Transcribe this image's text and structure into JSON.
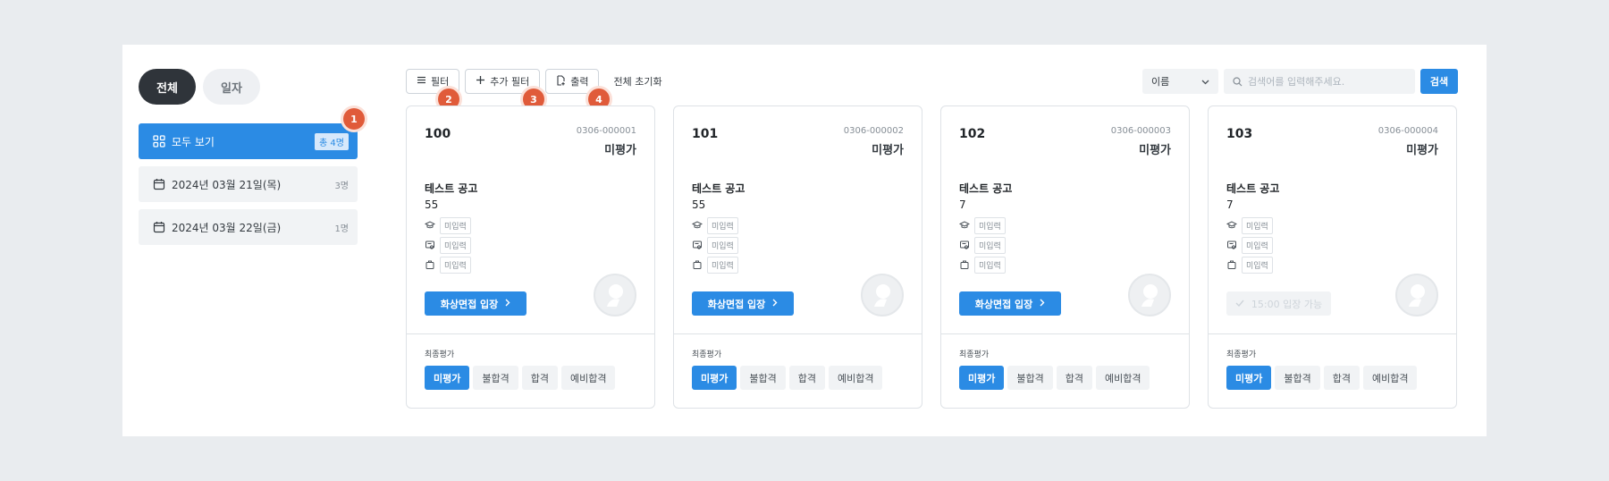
{
  "segments": [
    "전체",
    "일자"
  ],
  "sidebar": [
    {
      "label": "모두 보기",
      "count": "총 4명",
      "icon": "grid-icon"
    },
    {
      "label": "2024년 03월 21일(목)",
      "count": "3명",
      "icon": "calendar-icon"
    },
    {
      "label": "2024년 03월 22일(금)",
      "count": "1명",
      "icon": "calendar-icon"
    }
  ],
  "toolbar": {
    "filter": "필터",
    "add_filter": "추가 필터",
    "print": "출력",
    "reset": "전체 초기화"
  },
  "badges": [
    "1",
    "2",
    "3",
    "4"
  ],
  "search": {
    "select_value": "이름",
    "placeholder": "검색어를 입력해주세요.",
    "button": "검색"
  },
  "cards": [
    {
      "num": "100",
      "code": "0306-000001",
      "status": "미평가",
      "title": "테스트 공고",
      "value": "55",
      "tags": [
        "미입력",
        "미입력",
        "미입력"
      ],
      "button": "화상면접 입장",
      "enabled": true,
      "selected_eval": 0
    },
    {
      "num": "101",
      "code": "0306-000002",
      "status": "미평가",
      "title": "테스트 공고",
      "value": "55",
      "tags": [
        "미입력",
        "미입력",
        "미입력"
      ],
      "button": "화상면접 입장",
      "enabled": true,
      "selected_eval": 0
    },
    {
      "num": "102",
      "code": "0306-000003",
      "status": "미평가",
      "title": "테스트 공고",
      "value": "7",
      "tags": [
        "미입력",
        "미입력",
        "미입력"
      ],
      "button": "화상면접 입장",
      "enabled": true,
      "selected_eval": 0
    },
    {
      "num": "103",
      "code": "0306-000004",
      "status": "미평가",
      "title": "테스트 공고",
      "value": "7",
      "tags": [
        "미입력",
        "미입력",
        "미입력"
      ],
      "button": "15:00 입장 가능",
      "enabled": false,
      "selected_eval": 0
    }
  ],
  "final_label": "최종평가",
  "eval_options": [
    "미평가",
    "불합격",
    "합격",
    "예비합격"
  ],
  "colors": {
    "primary": "#2b8be4",
    "dark": "#2f343a",
    "badge": "#e05b3a"
  }
}
